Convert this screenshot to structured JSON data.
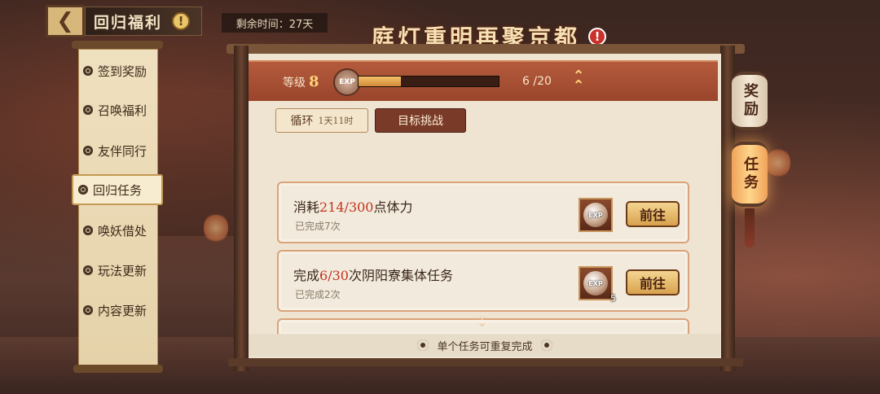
{
  "header": {
    "back_icon": "chevron-left-icon",
    "title": "回归福利",
    "title_info": "!",
    "remaining_time": "剩余时间：27天"
  },
  "event": {
    "title": "庭灯重明再聚京都",
    "info": "!"
  },
  "sidebar": {
    "items": [
      {
        "label": "签到奖励",
        "active": false
      },
      {
        "label": "召唤福利",
        "active": false
      },
      {
        "label": "友伴同行",
        "active": false
      },
      {
        "label": "回归任务",
        "active": true
      },
      {
        "label": "唤妖借处",
        "active": false
      },
      {
        "label": "玩法更新",
        "active": false
      },
      {
        "label": "内容更新",
        "active": false
      }
    ]
  },
  "level": {
    "label": "等级",
    "value": "8",
    "exp_badge": "EXP",
    "progress_text": "6 /20",
    "progress_current": 6,
    "progress_total": 20
  },
  "tabs": {
    "cycle_label": "循环",
    "cycle_time": "1天11时",
    "goal_label": "目标挑战"
  },
  "tasks": [
    {
      "prefix": "消耗",
      "progress": "214/300",
      "suffix": "点体力",
      "completed": "已完成7次",
      "reward_badge": "EXP",
      "reward_qty": "",
      "button": "前往"
    },
    {
      "prefix": "完成",
      "progress": "6/30",
      "suffix": "次阴阳寮集体任务",
      "completed": "已完成2次",
      "reward_badge": "EXP",
      "reward_qty": "5",
      "button": "前往"
    }
  ],
  "footer_note": "单个任务可重复完成",
  "right_tabs": {
    "reward": "奖励",
    "task": "任务"
  },
  "colors": {
    "highlight": "#c6311e",
    "accent_gold": "#ffd37a",
    "panel_red": "#a84e33"
  }
}
